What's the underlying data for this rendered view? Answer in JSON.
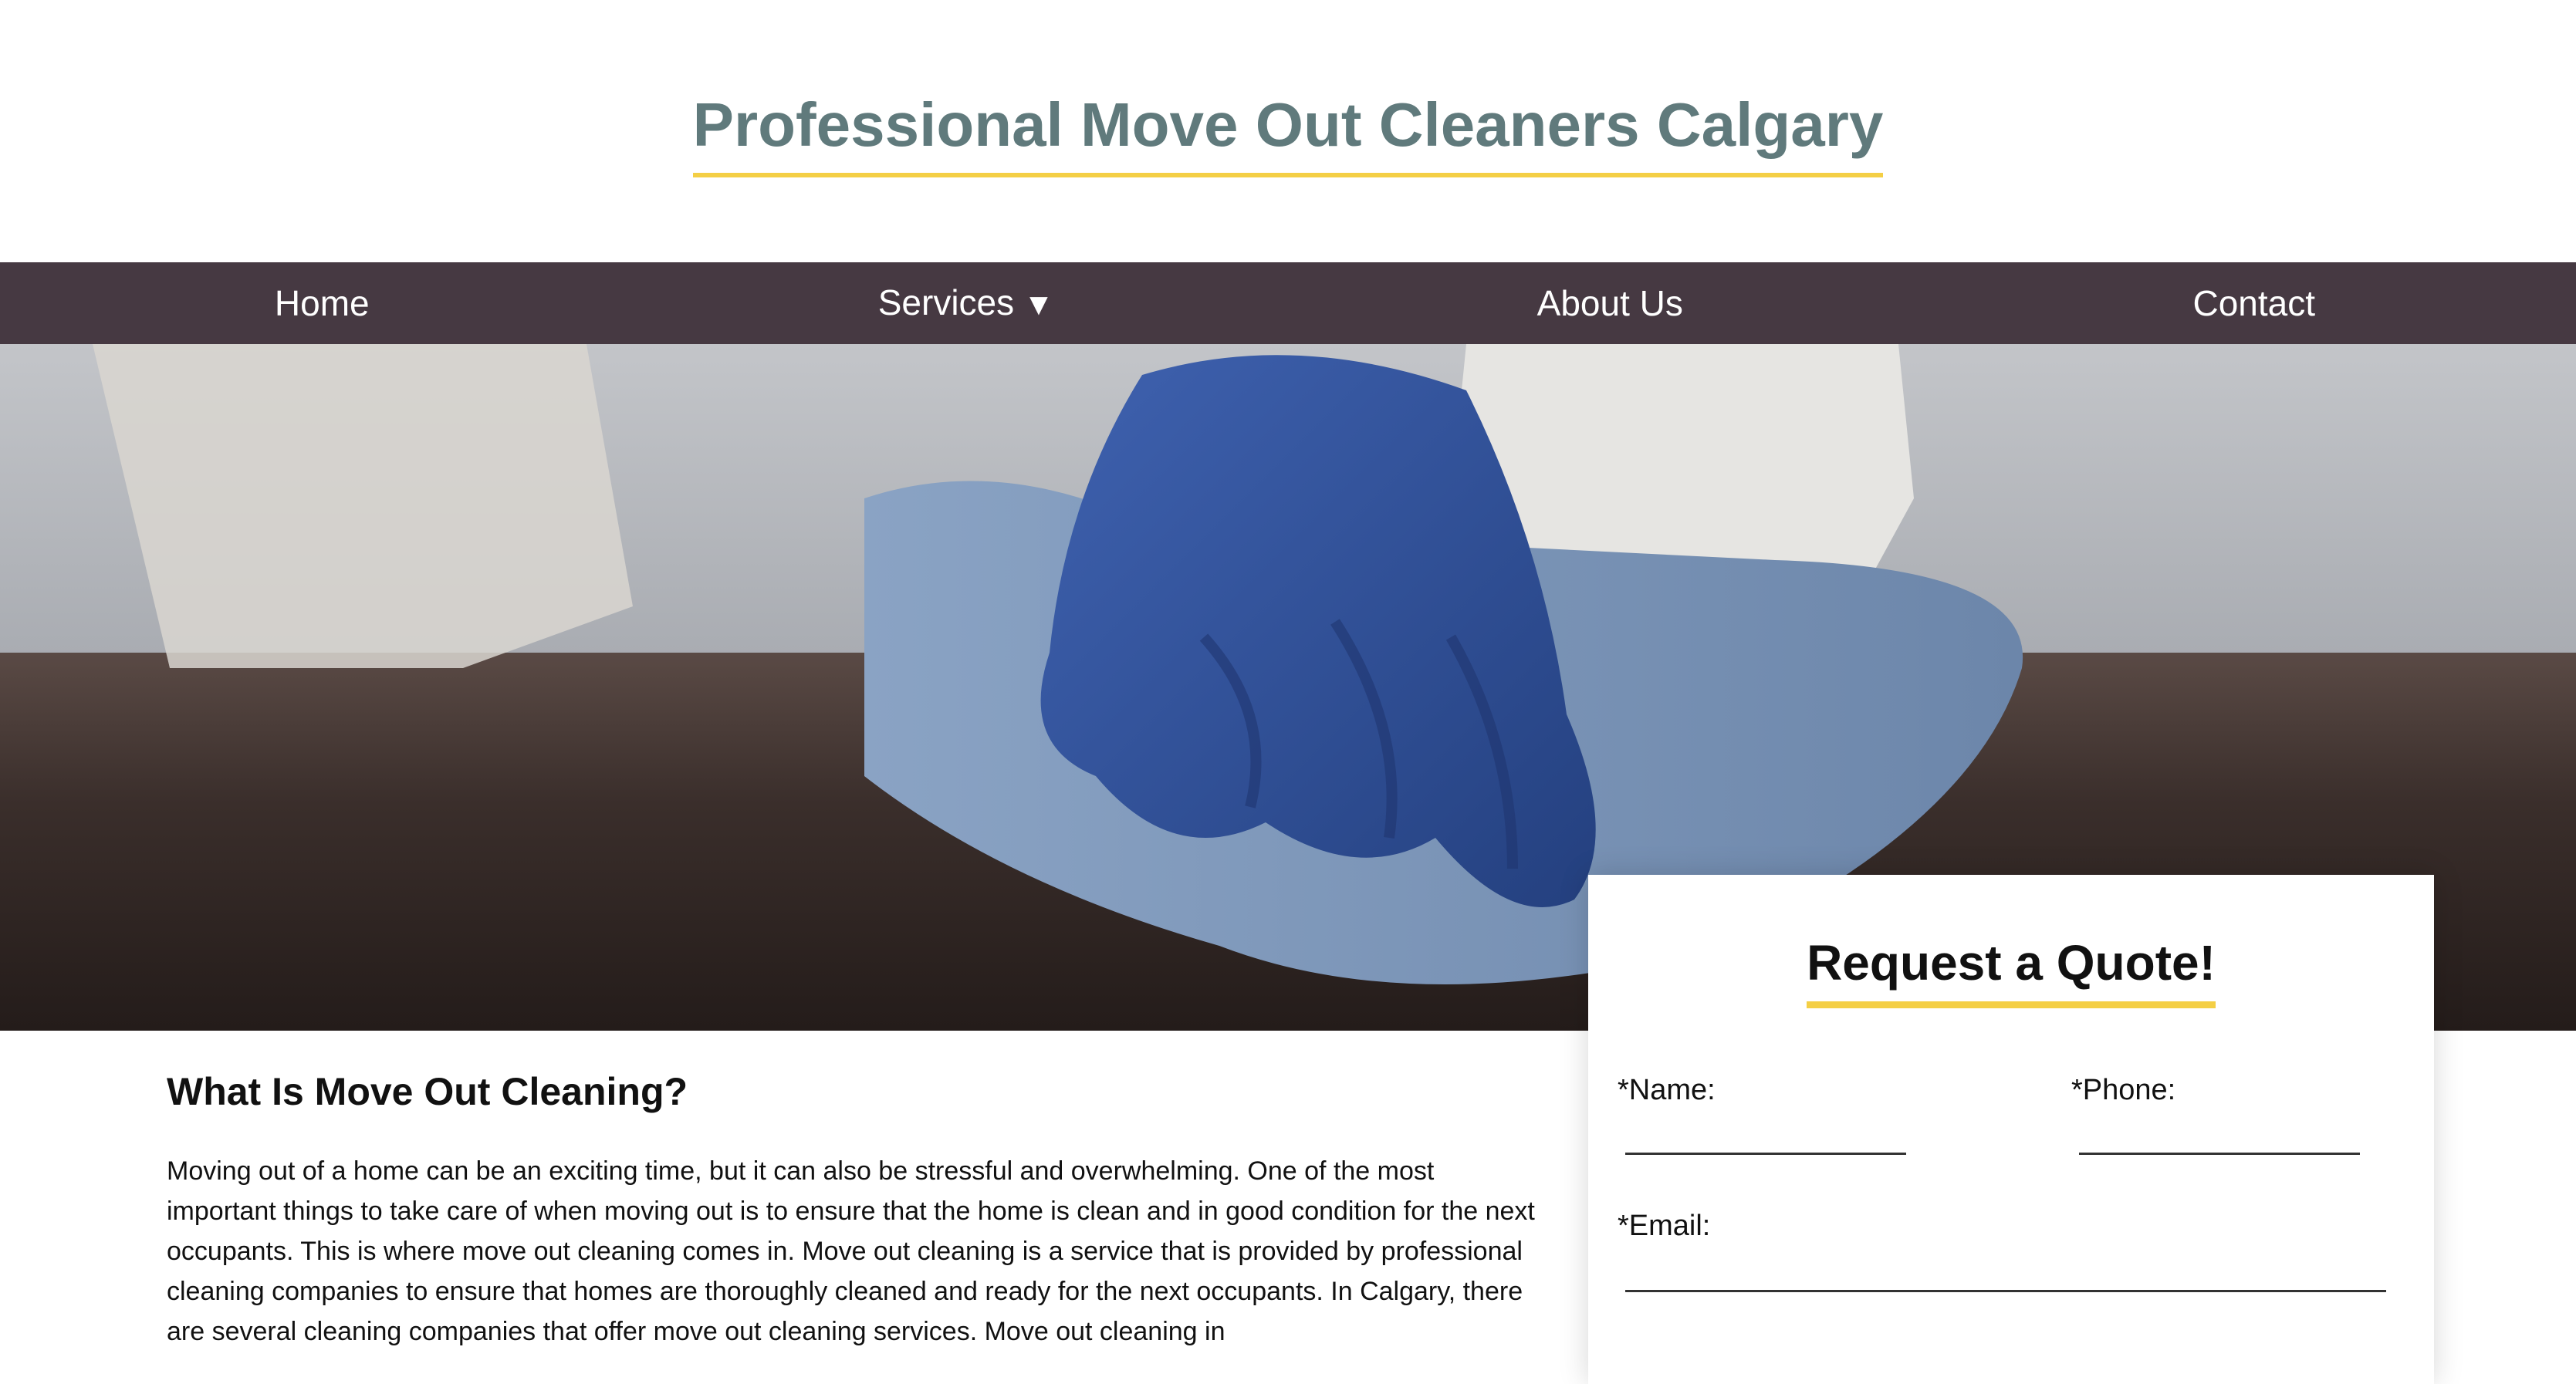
{
  "header": {
    "title": "Professional Move Out Cleaners Calgary"
  },
  "nav": {
    "items": [
      {
        "label": "Home"
      },
      {
        "label": "Services",
        "caret": "▼"
      },
      {
        "label": "About Us"
      },
      {
        "label": "Contact"
      }
    ]
  },
  "hero": {
    "image": "blue-gloved-hand-wiping-table-with-cloth"
  },
  "main": {
    "heading": "What Is Move Out Cleaning?",
    "paragraph": "Moving out of a home can be an exciting time, but it can also be stressful and overwhelming. One of the most important things to take care of when moving out is to ensure that the home is clean and in good condition for the next occupants. This is where move out cleaning comes in. Move out cleaning is a service that is provided by professional cleaning companies to ensure that homes are thoroughly cleaned and ready for the next occupants. In Calgary, there are several cleaning companies that offer move out cleaning services. Move out cleaning in"
  },
  "quote": {
    "title": "Request a Quote!",
    "name_label": "*Name:",
    "name_value": "",
    "phone_label": "*Phone:",
    "phone_value": "",
    "email_label": "*Email:",
    "email_value": ""
  },
  "colors": {
    "title": "#607a7c",
    "accent": "#f4cf45",
    "nav_bg": "#463942"
  }
}
